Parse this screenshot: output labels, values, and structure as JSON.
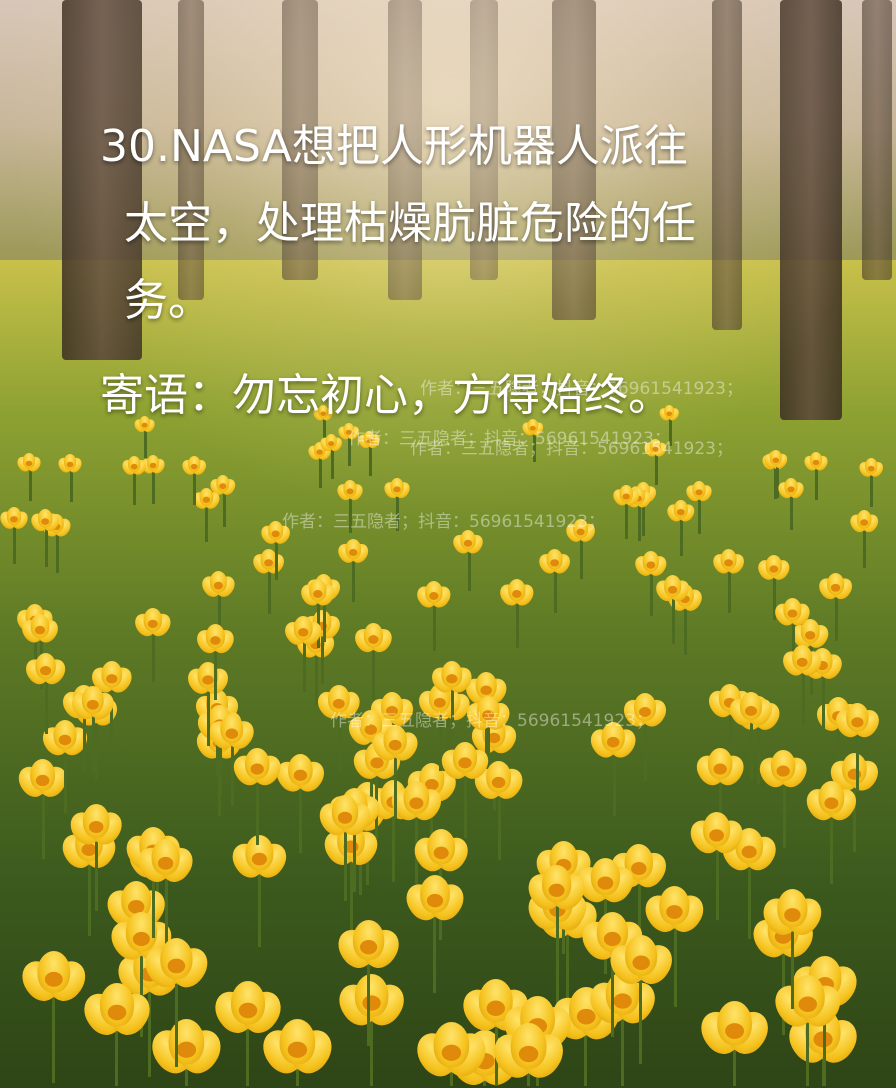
{
  "image": {
    "scene": "forest meadow with yellow wildflowers",
    "caption_lines": [
      "30.NASA想把人形机器人派往",
      "太空，处理枯燥肮脏危险的任",
      "务。"
    ],
    "motto": "寄语：勿忘初心，方得始终。",
    "watermarks": [
      "作者：三五隐者；抖音：56961541923；",
      "作者：三五隐者；抖音：56961541923；",
      "作者：三五隐者；抖音：56961541923；",
      "作者：三五隐者；抖音：56961541923；",
      "作者：三五隐者；抖音：56961541923；"
    ],
    "colors": {
      "text": "#ffffff",
      "flower": "#f5c21d",
      "grass": "#5e7a25"
    }
  }
}
